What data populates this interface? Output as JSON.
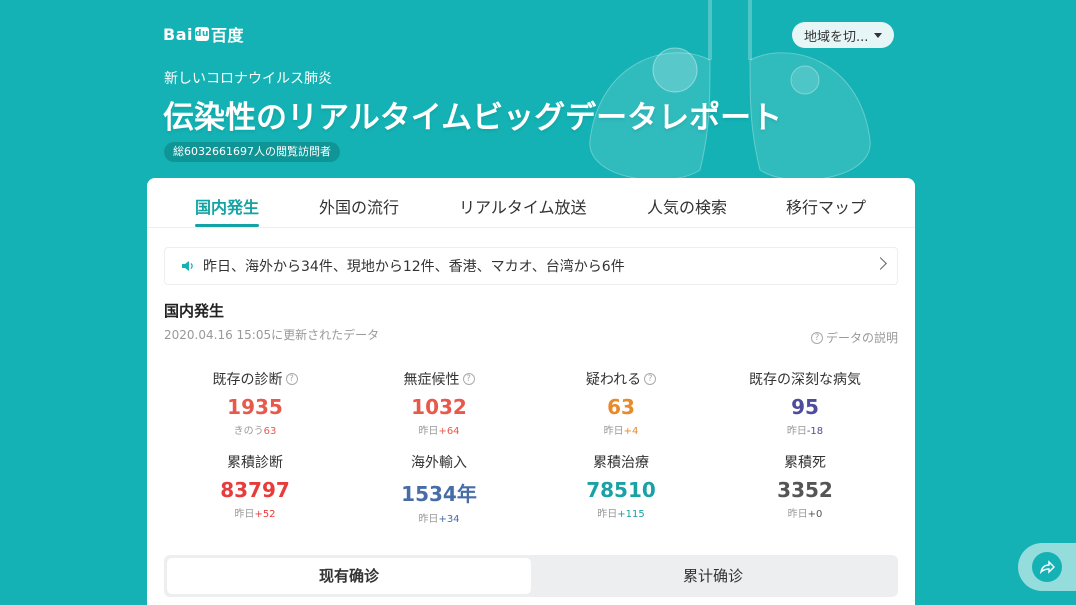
{
  "header": {
    "logo_text": "Bai",
    "logo_paw": "du",
    "logo_cn": "百度",
    "region_button": "地域を切...",
    "subtitle": "新しいコロナウイルス肺炎",
    "title": "伝染性のリアルタイムビッグデータレポート",
    "visitors": "総6032661697人の閲覧訪問者"
  },
  "tabs": [
    "国内発生",
    "外国の流行",
    "リアルタイム放送",
    "人気の検索",
    "移行マップ"
  ],
  "notice": "昨日、海外から34件、現地から12件、香港、マカオ、台湾から6件",
  "section": {
    "title": "国内発生",
    "updated": "2020.04.16 15:05に更新されたデータ",
    "explain": "データの説明"
  },
  "stats_row1": [
    {
      "label": "既存の診断",
      "value": "1935",
      "change_prefix": "きのう",
      "change": "63",
      "color": "#e8584b",
      "change_color": "#e8584b"
    },
    {
      "label": "無症候性",
      "value": "1032",
      "change_prefix": "昨日",
      "change": "+64",
      "color": "#e8584b",
      "change_color": "#e8584b"
    },
    {
      "label": "疑われる",
      "value": "63",
      "change_prefix": "昨日",
      "change": "+4",
      "color": "#e8892a",
      "change_color": "#e8892a"
    },
    {
      "label": "既存の深刻な病気",
      "value": "95",
      "change_prefix": "昨日",
      "change": "-18",
      "color": "#4e4c9c",
      "change_color": "#4e4c9c"
    }
  ],
  "stats_row2": [
    {
      "label": "累積診断",
      "value": "83797",
      "change_prefix": "昨日",
      "change": "+52",
      "color": "#e83b3b",
      "change_color": "#e83b3b"
    },
    {
      "label": "海外輸入",
      "value": "1534年",
      "change_prefix": "昨日",
      "change": "+34",
      "color": "#476da7",
      "change_color": "#476da7"
    },
    {
      "label": "累積治療",
      "value": "78510",
      "change_prefix": "昨日",
      "change": "+115",
      "color": "#1aa1a5",
      "change_color": "#1aa1a5"
    },
    {
      "label": "累積死",
      "value": "3352",
      "change_prefix": "昨日",
      "change": "+0",
      "color": "#555555",
      "change_color": "#555555"
    }
  ],
  "toggle": {
    "on": "现有确诊",
    "off": "累计确诊"
  },
  "share": "share-icon"
}
